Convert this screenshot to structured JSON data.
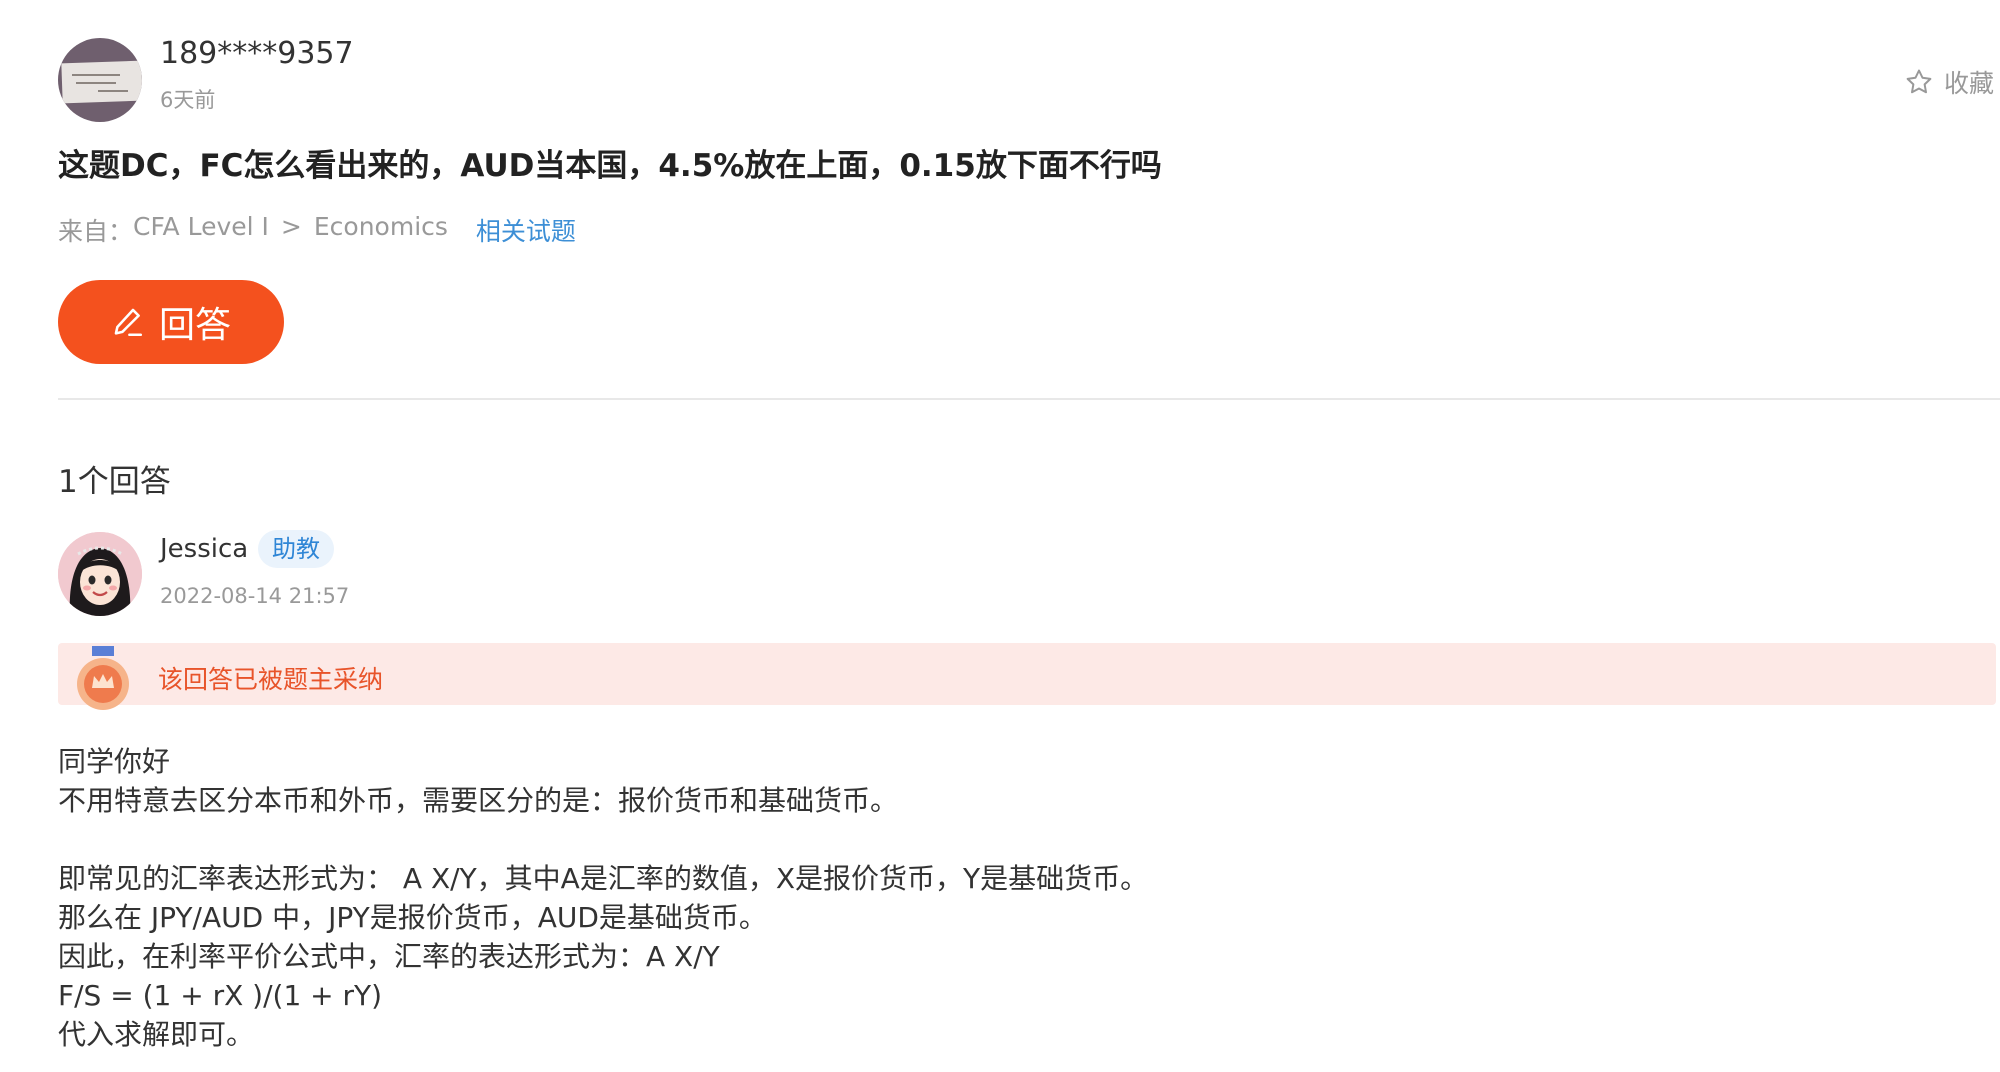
{
  "question": {
    "user": "189****9357",
    "time": "6天前",
    "title": "这题DC，FC怎么看出来的，AUD当本国，4.5%放在上面，0.15放下面不行吗",
    "source_prefix": "来自：",
    "source_course": "CFA Level I",
    "source_sep": ">",
    "source_topic": "Economics",
    "related_link": "相关试题"
  },
  "favorite": {
    "label": "收藏",
    "icon": "star-outline-icon"
  },
  "answer_button": {
    "label": "回答",
    "icon": "pencil-icon",
    "color": "#f4511e"
  },
  "answers": {
    "count_label": "1个回答",
    "items": [
      {
        "author": "Jessica",
        "role_badge": "助教",
        "time": "2022-08-14 21:57",
        "accepted_label": "该回答已被题主采纳",
        "lines": [
          "同学你好",
          "不用特意去区分本币和外币，需要区分的是：报价货币和基础货币。",
          "",
          "即常见的汇率表达形式为： A X/Y，其中A是汇率的数值，X是报价货币，Y是基础货币。",
          "那么在 JPY/AUD 中，JPY是报价货币，AUD是基础货币。",
          "因此，在利率平价公式中，汇率的表达形式为：A X/Y",
          "F/S = (1 + rX )/(1 + rY)",
          "代入求解即可。"
        ]
      }
    ]
  },
  "colors": {
    "accent": "#f4511e",
    "link": "#3d8fd6",
    "accepted_bg": "#fde9e6",
    "accepted_text": "#e8542a"
  }
}
